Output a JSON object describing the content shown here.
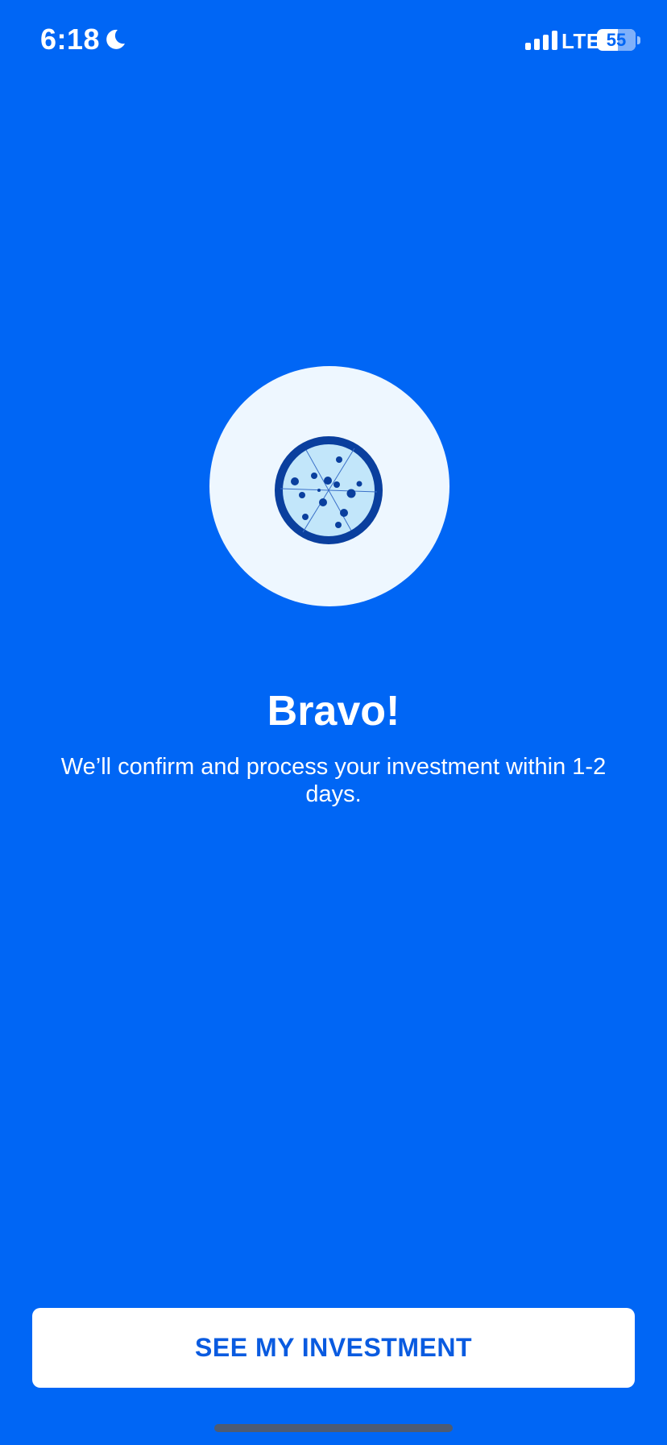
{
  "status_bar": {
    "time": "6:18",
    "network": "LTE",
    "battery": "55",
    "icons": [
      "moon-icon",
      "signal-icon",
      "battery-icon"
    ]
  },
  "hero": {
    "icon": "pizza-icon"
  },
  "content": {
    "title": "Bravo!",
    "message": "We’ll confirm and process your investment within 1-2 days."
  },
  "actions": {
    "primary_label": "SEE MY INVESTMENT"
  },
  "colors": {
    "background": "#0066F5",
    "button_background": "#FFFFFF",
    "button_text": "#0A5BE0",
    "hero_circle": "#EEF7FF"
  }
}
